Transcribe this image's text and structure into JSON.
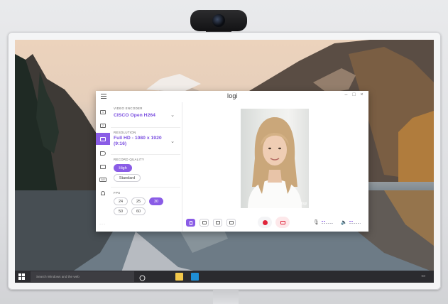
{
  "app": {
    "logo": "logi",
    "window_controls": [
      "–",
      "□",
      "×"
    ]
  },
  "rail": {
    "items": [
      {
        "icon": "single-view-icon",
        "glyph": "1"
      },
      {
        "icon": "dual-view-icon",
        "glyph": "2"
      },
      {
        "icon": "camera-settings-icon",
        "glyph": "",
        "active": true
      },
      {
        "icon": "audio-icon",
        "glyph": ""
      },
      {
        "icon": "adjustments-icon",
        "glyph": ""
      },
      {
        "icon": "auto-mode-icon",
        "glyph": "AU"
      },
      {
        "icon": "person-icon",
        "glyph": ""
      }
    ],
    "more": "···"
  },
  "panel": {
    "encoder": {
      "label": "VIDEO ENCODER",
      "value": "CISCO Open H264"
    },
    "resolution": {
      "label": "RESOLUTION",
      "value_line1": "Full HD - 1080 x 1920",
      "value_line2": "(9:16)"
    },
    "quality": {
      "label": "RECORD QUALITY",
      "options": [
        "High",
        "Standard"
      ],
      "selected": "High"
    },
    "fps": {
      "label": "FPS",
      "options": [
        "24",
        "25",
        "30",
        "50",
        "60"
      ],
      "selected": "30"
    }
  },
  "preview": {
    "watermark": "logi"
  },
  "toolbar": {
    "views": [
      "portrait-layout-icon",
      "landscape-layout-icon",
      "picture-in-picture-icon",
      "side-by-side-icon"
    ],
    "record": "record-icon",
    "snapshot": "camera-icon",
    "mic": "microphone-icon",
    "speaker": "speaker-icon"
  },
  "taskbar": {
    "search_placeholder": "Search Windows and the web",
    "tray_icon": "notification-icon"
  },
  "colors": {
    "accent": "#8a5ce6",
    "record": "#e0243a",
    "taskbar": "#2b2b2f"
  }
}
